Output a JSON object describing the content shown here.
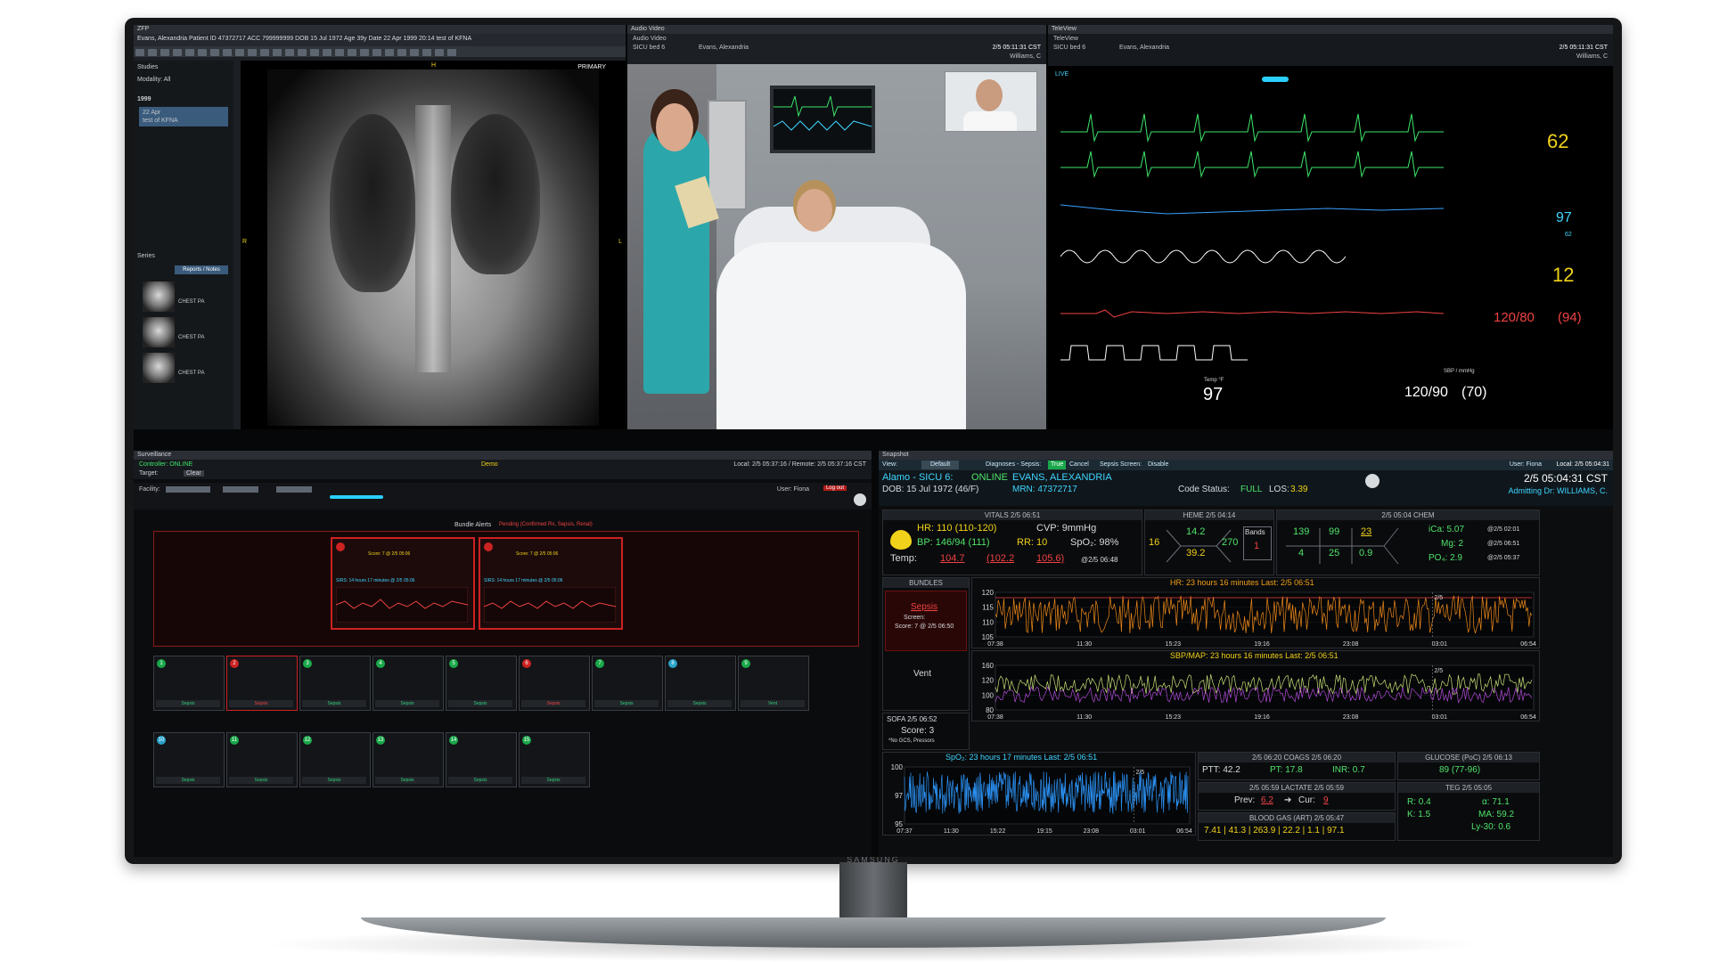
{
  "monitor": {
    "brand": "SAMSUNG"
  },
  "xray": {
    "window_title": "ZFP",
    "patient_line": "Evans, Alexandria    Patient ID 47372717    ACC 799999999    DOB 15 Jul 1972    Age 39y    Date 22 Apr 1999    20:14    test of KFNA",
    "studies_label": "Studies",
    "modality_label": "Modality: All",
    "year": "1999",
    "study_date": "22 Apr",
    "study_desc": "test of KFNA",
    "series_label": "Series",
    "series_button": "Reports / Notes",
    "series_items": [
      "CHEST PA",
      "CHEST PA",
      "CHEST PA"
    ],
    "corner_primary": "PRIMARY",
    "marker_h": "H",
    "marker_r": "R",
    "marker_l": "L"
  },
  "video": {
    "window_title": "Audio Video",
    "subtitle": "Audio Video",
    "bed": "SICU bed 6",
    "patient": "Evans, Alexandria",
    "time": "2/5 05:11:31 CST",
    "doctor": "Williams, C"
  },
  "telemonitor": {
    "window_title": "TeleView",
    "subtitle": "TeleView",
    "bed": "SICU bed 6",
    "patient": "Evans, Alexandria",
    "time": "2/5 05:11:31 CST",
    "doctor": "Williams, C",
    "live_tab": "LIVE",
    "hr": "62",
    "spo2": "97",
    "pulse": "62",
    "resp": "12",
    "nibp": "120/80",
    "nibp_mean": "(94)",
    "temp": "97",
    "art": "120/90",
    "art_mean": "(70)",
    "temp_label": "Temp °F",
    "sbp_label": "SBP / mmHg"
  },
  "surveillance": {
    "window_title": "Surveillance",
    "controller": "Controller: ONLINE",
    "target": "Target:",
    "clear": "Clear",
    "demo": "Demo",
    "local_remote": "Local: 2/5 05:37:16 / Remote: 2/5 05:37:16 CST",
    "facility_label": "Facility:",
    "user": "User: Fiona",
    "logout": "Log out",
    "bundle_alerts": "Bundle Alerts",
    "bundle_alerts_sub": "Pending (Confirmed Rx, Sepsis, Renal)",
    "alert_cards": [
      {
        "score": "Score: 7 @ 2/5 05:06",
        "sirs": "SIRS: 14 hours 17 minutes @ 2/5 05:06"
      },
      {
        "score": "Score: 7 @ 2/5 05:06",
        "sirs": "SIRS: 14 hours 17 minutes @ 2/5 05:06"
      }
    ],
    "tile_band": "Sepsis",
    "tile_vent": "Vent"
  },
  "snapshot": {
    "window_title": "Snapshot",
    "view_label": "View:",
    "view_value": "Default",
    "diagnoses": "Diagnoses - Sepsis:",
    "diag_true": "True",
    "diag_cancel": "Cancel",
    "sepsis_screen": "Sepsis Screen:",
    "sepsis_disable": "Disable",
    "user": "User: Fiona",
    "local_time": "Local: 2/5 05:04:31",
    "unit_line": "Alamo - SICU 6:",
    "online": "ONLINE",
    "patient_name": "EVANS, ALEXANDRIA",
    "dob": "DOB: 15 Jul 1972 (46/F)",
    "mrn": "MRN: 47372717",
    "code_status_label": "Code Status:",
    "code_status": "FULL",
    "los_label": "LOS:",
    "los": "3.39",
    "time": "2/5 05:04:31 CST",
    "admitting": "Admitting Dr: WILLIAMS, C.",
    "vitals": {
      "title": "VITALS 2/5 06:51",
      "hr": "HR: 110 (110-120)",
      "cvp": "CVP: 9mmHg",
      "bp": "BP: 146/94 (111)",
      "rr": "RR: 10",
      "spo2": "SpO₂: 98%",
      "temp_label": "Temp:",
      "temp1": "104.7",
      "temp2": "(102.2",
      "temp3": "105.6)",
      "temp_time": "@2/5 06:48"
    },
    "heme": {
      "title": "HEME 2/5 04:14",
      "wbc": "16",
      "hgb": "14.2",
      "hct": "39.2",
      "plt": "270",
      "bands_label": "Bands",
      "bands": "1"
    },
    "chem": {
      "title": "2/5 05:04 CHEM",
      "na": "139",
      "cl": "99",
      "bun": "23",
      "k": "4",
      "co2": "25",
      "cr": "0.9",
      "ica": "iCa: 5.07",
      "ica_t": "@2/5 02:01",
      "mg": "Mg: 2",
      "mg_t": "@2/5 06:51",
      "po4": "PO₄: 2.9",
      "po4_t": "@2/5 05:37"
    },
    "bundles": {
      "title": "BUNDLES",
      "sepsis": "Sepsis",
      "screen": "Screen:",
      "score": "Score: 7 @ 2/5 06:50",
      "vent": "Vent",
      "sofa_title": "SOFA 2/5 06:52",
      "sofa_score": "Score: 3",
      "sofa_note": "*No GCS, Pressors"
    },
    "charts": {
      "hr_title": "HR: 23 hours 16 minutes  Last: 2/5 06:51",
      "sbp_title": "SBP/MAP: 23 hours 16 minutes  Last: 2/5 06:51",
      "spo2_title": "SpO₂: 23 hours 17 minutes  Last: 2/5 06:51",
      "times_hr": [
        "07:38",
        "11:30",
        "15:23",
        "19:16",
        "23:08",
        "03:01",
        "06:54"
      ],
      "times_sbp": [
        "07:38",
        "11:30",
        "15:23",
        "19:16",
        "23:08",
        "03:01",
        "06:54"
      ],
      "times_spo2": [
        "07:37",
        "11:30",
        "15:22",
        "19:15",
        "23:08",
        "03:01",
        "06:54"
      ],
      "hr_ticks": [
        "120",
        "115",
        "110",
        "105"
      ],
      "sbp_ticks": [
        "160",
        "120",
        "100",
        "80"
      ],
      "spo2_ticks": [
        "100",
        "97",
        "95"
      ],
      "marker": "2/5"
    },
    "coags": {
      "title": "2/5 06:20 COAGS 2/5 06:20",
      "ptt": "PTT: 42.2",
      "pt": "PT: 17.8",
      "inr": "INR: 0.7"
    },
    "glucose": {
      "title": "GLUCOSE (PoC) 2/5 06:13",
      "value": "89 (77-96)"
    },
    "lactate": {
      "title": "2/5 05:59 LACTATE 2/5 05:59",
      "prev_label": "Prev:",
      "prev": "6.2",
      "cur_label": "Cur:",
      "cur": "9"
    },
    "teg": {
      "title": "TEG 2/5 05:05",
      "r": "R: 0.4",
      "alpha": "α: 71.1",
      "k": "K: 1.5",
      "ma": "MA: 59.2",
      "ly30": "Ly-30: 0.6"
    },
    "blood_gas": {
      "title": "BLOOD GAS (ART) 2/5 05:47",
      "values": "7.41 | 41.3 | 263.9 | 22.2 | 1.1 | 97.1"
    }
  }
}
